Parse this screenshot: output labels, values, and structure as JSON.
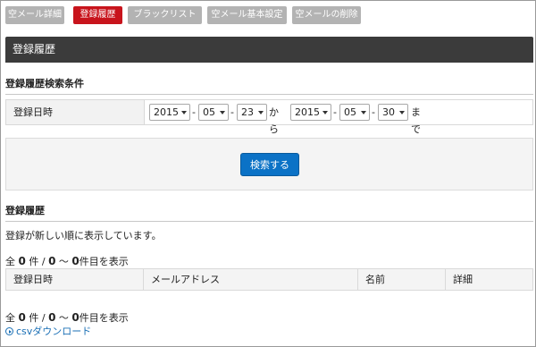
{
  "tabs": [
    {
      "label": "空メール詳細",
      "active": false
    },
    {
      "label": "登録履歴",
      "active": true
    },
    {
      "label": "ブラックリスト",
      "active": false
    },
    {
      "label": "空メール基本設定",
      "active": false
    },
    {
      "label": "空メールの削除",
      "active": false
    }
  ],
  "page": {
    "title": "登録履歴"
  },
  "search": {
    "section_title": "登録履歴検索条件",
    "date_label": "登録日時",
    "from": {
      "year": "2015",
      "month": "05",
      "day": "23"
    },
    "to": {
      "year": "2015",
      "month": "05",
      "day": "30"
    },
    "dash": "-",
    "from_text": "から",
    "until_text": "まで",
    "button_label": "検索する"
  },
  "history": {
    "section_title": "登録履歴",
    "note": "登録が新しい順に表示しています。",
    "counter_prefix": "全",
    "total": "0",
    "counter_mid": "件 /",
    "range_start": "0",
    "range_sep": "〜",
    "range_end": "0",
    "counter_suffix": "件目を表示",
    "columns": [
      "登録日時",
      "メールアドレス",
      "名前",
      "詳細"
    ]
  },
  "csv": {
    "label": "csvダウンロード"
  },
  "colors": {
    "active_tab": "#c8141c",
    "header_bar": "#3b3b3b",
    "primary_button": "#0b72c6",
    "link": "#1a6fb5"
  }
}
